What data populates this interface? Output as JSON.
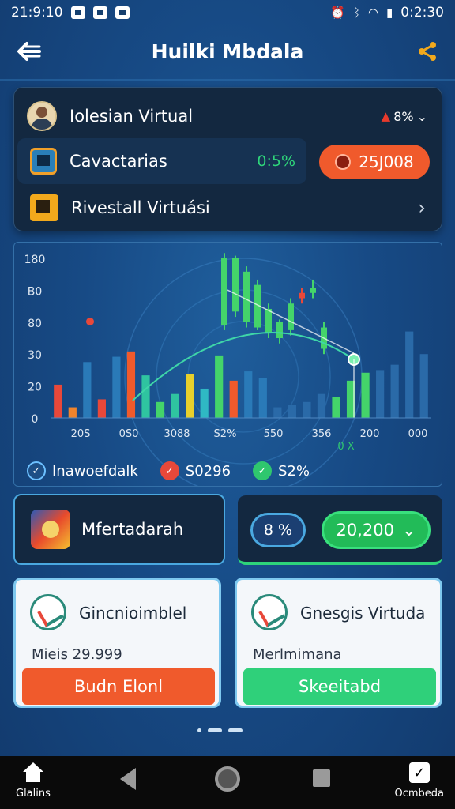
{
  "status_bar": {
    "time_left": "21:9:10",
    "time_right": "0:2:30"
  },
  "header": {
    "title": "Huilki Mbdala"
  },
  "top_card": {
    "row1_label": "Iolesian Virtual",
    "row1_value": "8%",
    "row2_label": "Cavactarias",
    "row2_value": "0:5%",
    "row2_pill": "25J008",
    "row3_label": "Rivestall Virtuási"
  },
  "chart_data": {
    "type": "bar",
    "y_ticks": [
      "0",
      "20",
      "30",
      "80",
      "B0",
      "180"
    ],
    "x_ticks": [
      "20S",
      "0S0",
      "3088",
      "S2%",
      "550",
      "356",
      "200",
      "000"
    ],
    "x_extra_label": "0 X",
    "bars": [
      {
        "value": 25,
        "color": "#e8483a"
      },
      {
        "value": 8,
        "color": "#f0842c"
      },
      {
        "value": 42,
        "color": "#2a7ab8"
      },
      {
        "value": 14,
        "color": "#e8483a"
      },
      {
        "value": 46,
        "color": "#2a7ab8"
      },
      {
        "value": 50,
        "color": "#f05a2c"
      },
      {
        "value": 32,
        "color": "#2fc4a0"
      },
      {
        "value": 12,
        "color": "#44d46a"
      },
      {
        "value": 18,
        "color": "#2fc4a0"
      },
      {
        "value": 33,
        "color": "#e8d02c"
      },
      {
        "value": 22,
        "color": "#2fb8c4"
      },
      {
        "value": 47,
        "color": "#44d46a"
      },
      {
        "value": 28,
        "color": "#f05a2c"
      },
      {
        "value": 35,
        "color": "#2a7ab8"
      },
      {
        "value": 30,
        "color": "#2a7ab8"
      },
      {
        "value": 8,
        "color": "#2a6aa8"
      },
      {
        "value": 10,
        "color": "#2a6aa8"
      },
      {
        "value": 12,
        "color": "#2a6aa8"
      },
      {
        "value": 18,
        "color": "#2a6aa8"
      },
      {
        "value": 16,
        "color": "#44d46a"
      },
      {
        "value": 28,
        "color": "#44d46a"
      },
      {
        "value": 34,
        "color": "#44d46a"
      },
      {
        "value": 36,
        "color": "#2a6aa8"
      },
      {
        "value": 40,
        "color": "#2a6aa8"
      },
      {
        "value": 65,
        "color": "#2a6aa8"
      },
      {
        "value": 48,
        "color": "#2a6aa8"
      }
    ],
    "candles": [
      {
        "open": 70,
        "close": 120,
        "high": 124,
        "low": 66,
        "color": "#44d46a"
      },
      {
        "open": 80,
        "close": 120,
        "high": 122,
        "low": 76,
        "color": "#44d46a"
      },
      {
        "open": 72,
        "close": 110,
        "high": 114,
        "low": 68,
        "color": "#44d46a"
      },
      {
        "open": 68,
        "close": 100,
        "high": 104,
        "low": 66,
        "color": "#44d46a"
      },
      {
        "open": 64,
        "close": 82,
        "high": 86,
        "low": 60,
        "color": "#44d46a"
      },
      {
        "open": 60,
        "close": 72,
        "high": 74,
        "low": 56,
        "color": "#44d46a"
      },
      {
        "open": 66,
        "close": 86,
        "high": 90,
        "low": 62,
        "color": "#44d46a"
      },
      {
        "open": 90,
        "close": 94,
        "high": 98,
        "low": 86,
        "color": "#e8483a"
      },
      {
        "open": 94,
        "close": 98,
        "high": 104,
        "low": 90,
        "color": "#44d46a"
      },
      {
        "open": 52,
        "close": 68,
        "high": 72,
        "low": 48,
        "color": "#44d46a"
      }
    ],
    "ymax": 120
  },
  "legend": [
    {
      "icon": "check",
      "label": "Inawoefdalk"
    },
    {
      "icon": "check",
      "label": "S0296"
    },
    {
      "icon": "check",
      "label": "S2%"
    }
  ],
  "middle": {
    "card_label": "Mfertadarah",
    "blue_pill": "8 %",
    "green_pill": "20,200"
  },
  "bottom_cards": [
    {
      "title": "Gincnioimblel",
      "sub": "Mieis 29.999",
      "button": "Budn Elonl"
    },
    {
      "title": "Gnesgis Virtuda",
      "sub": "Merlmimana",
      "button": "Skeeitabd"
    }
  ],
  "nav": {
    "left_label": "Glalins",
    "right_label": "Ocmbeda"
  },
  "colors": {
    "accent_orange": "#f05a2c",
    "accent_green": "#2fd07a",
    "background": "#174a85"
  }
}
